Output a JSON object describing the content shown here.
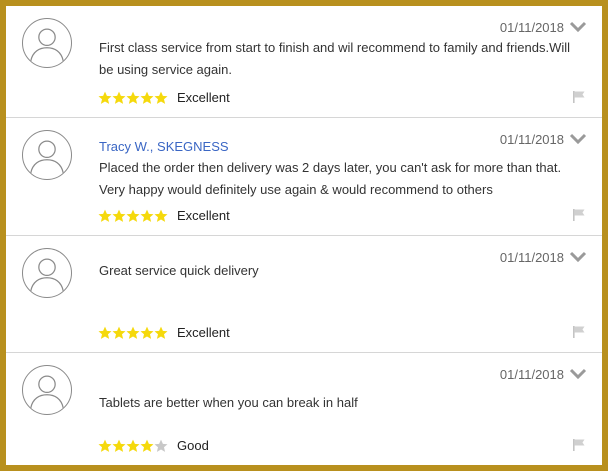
{
  "colors": {
    "frame": "#b8901e",
    "star_filled": "#f5d90c",
    "star_empty": "#c8c8c8",
    "author": "#3a66c4"
  },
  "reviews": [
    {
      "author": "",
      "date": "01/11/2018",
      "text": "First class service from start to finish and wil recommend to family and friends.Will be using service again.",
      "rating": 5,
      "rating_label": "Excellent"
    },
    {
      "author": "Tracy W., SKEGNESS",
      "date": "01/11/2018",
      "text": "Placed the order then delivery was 2 days later, you can't ask for more than that. Very happy would definitely use again & would recommend to others",
      "rating": 5,
      "rating_label": "Excellent"
    },
    {
      "author": "",
      "date": "01/11/2018",
      "text": "Great service quick delivery",
      "rating": 5,
      "rating_label": "Excellent"
    },
    {
      "author": "",
      "date": "01/11/2018",
      "text": "Tablets are better when you can break in half",
      "rating": 4,
      "rating_label": "Good"
    }
  ],
  "icons": {
    "avatar": "user-avatar-icon",
    "expand": "chevron-down-icon",
    "report": "flag-icon",
    "star": "star-icon"
  }
}
